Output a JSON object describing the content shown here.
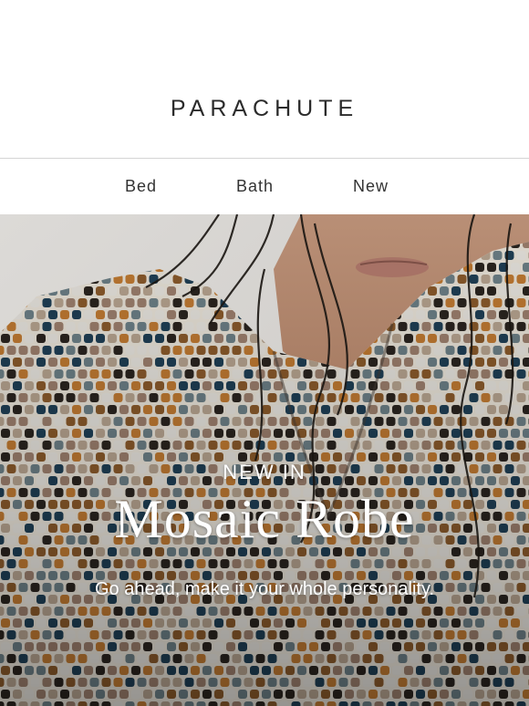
{
  "brand": {
    "logo_text": "PARACHUTE"
  },
  "nav": {
    "items": [
      {
        "label": "Bed"
      },
      {
        "label": "Bath"
      },
      {
        "label": "New"
      }
    ]
  },
  "hero": {
    "eyebrow": "NEW IN",
    "title": "Mosaic Robe",
    "subtitle": "Go ahead, make it your whole personality.",
    "image_icon": "robe-model-photo"
  },
  "colors": {
    "background": "#ffffff",
    "divider": "#d4d4d4",
    "text": "#2b2b2b",
    "hero_text": "#ffffff",
    "robe_pattern": [
      "#2a241f",
      "#8a5a2b",
      "#c07a32",
      "#e7e4de",
      "#6c7f86",
      "#1f3f55",
      "#9c7f6d",
      "#b6a38f"
    ]
  }
}
